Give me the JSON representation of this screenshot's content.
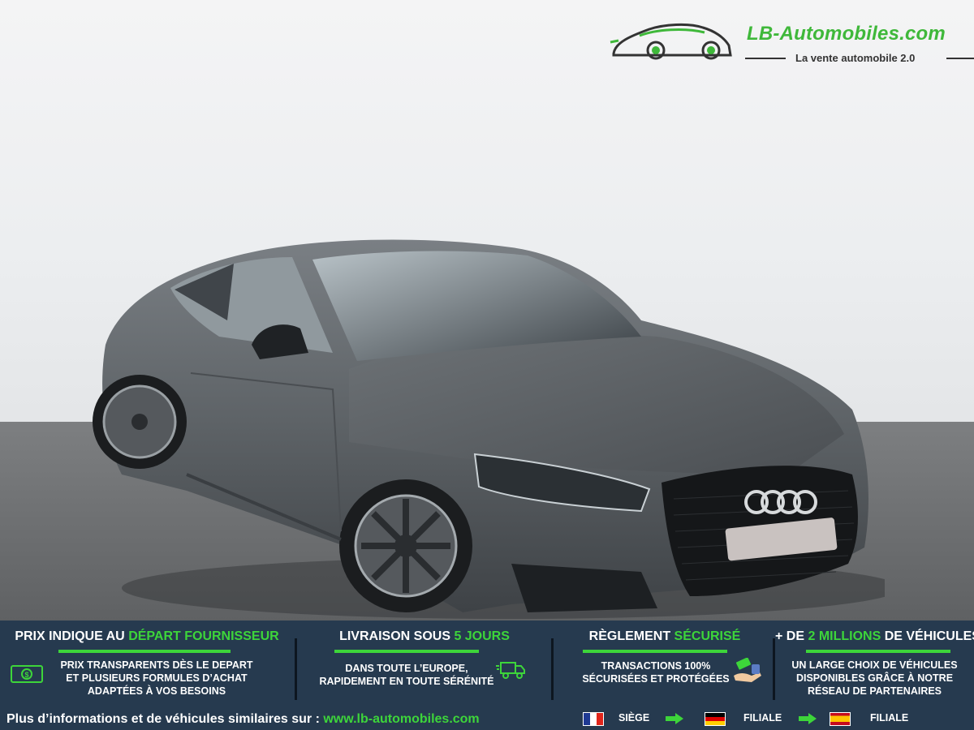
{
  "logo": {
    "brand": "LB-Automobiles.com",
    "tagline": "La vente automobile 2.0"
  },
  "colors": {
    "accent": "#3dd53a",
    "footer_bg": "#263a4f",
    "car_body": "#5d6266"
  },
  "features": [
    {
      "title_pre": "PRIX INDIQUE AU ",
      "title_hl": "DÉPART FOURNISSEUR",
      "title_post": "",
      "lines": [
        "PRIX TRANSPARENTS DÈS LE DEPART",
        "ET PLUSIEURS FORMULES D’ACHAT",
        "ADAPTÉES À VOS BESOINS"
      ],
      "icon": "banknote-icon"
    },
    {
      "title_pre": "LIVRAISON SOUS ",
      "title_hl": "5 JOURS",
      "title_post": "",
      "lines": [
        "DANS TOUTE L’EUROPE,",
        "RAPIDEMENT EN TOUTE SÉRÉNITÉ"
      ],
      "icon": "delivery-truck-icon"
    },
    {
      "title_pre": "RÈGLEMENT ",
      "title_hl": "SÉCURISÉ",
      "title_post": "",
      "lines": [
        "TRANSACTIONS 100%",
        "SÉCURISÉES ET PROTÉGÉES"
      ],
      "icon": "hand-payment-icon"
    },
    {
      "title_pre": "+ DE ",
      "title_hl": "2 MILLIONS",
      "title_post": " DE VÉHICULES",
      "lines": [
        "UN LARGE CHOIX DE VÉHICULES",
        "DISPONIBLES GRÂCE À NOTRE",
        "RÉSEAU DE PARTENAIRES"
      ],
      "icon": ""
    }
  ],
  "footer": {
    "more_text": "Plus d’informations et de véhicules similaires sur : ",
    "url": "www.lb-automobiles.com",
    "locations": [
      {
        "flag": "france-flag-icon",
        "label": "SIÈGE"
      },
      {
        "flag": "germany-flag-icon",
        "label": "FILIALE"
      },
      {
        "flag": "spain-flag-icon",
        "label": "FILIALE"
      }
    ]
  }
}
